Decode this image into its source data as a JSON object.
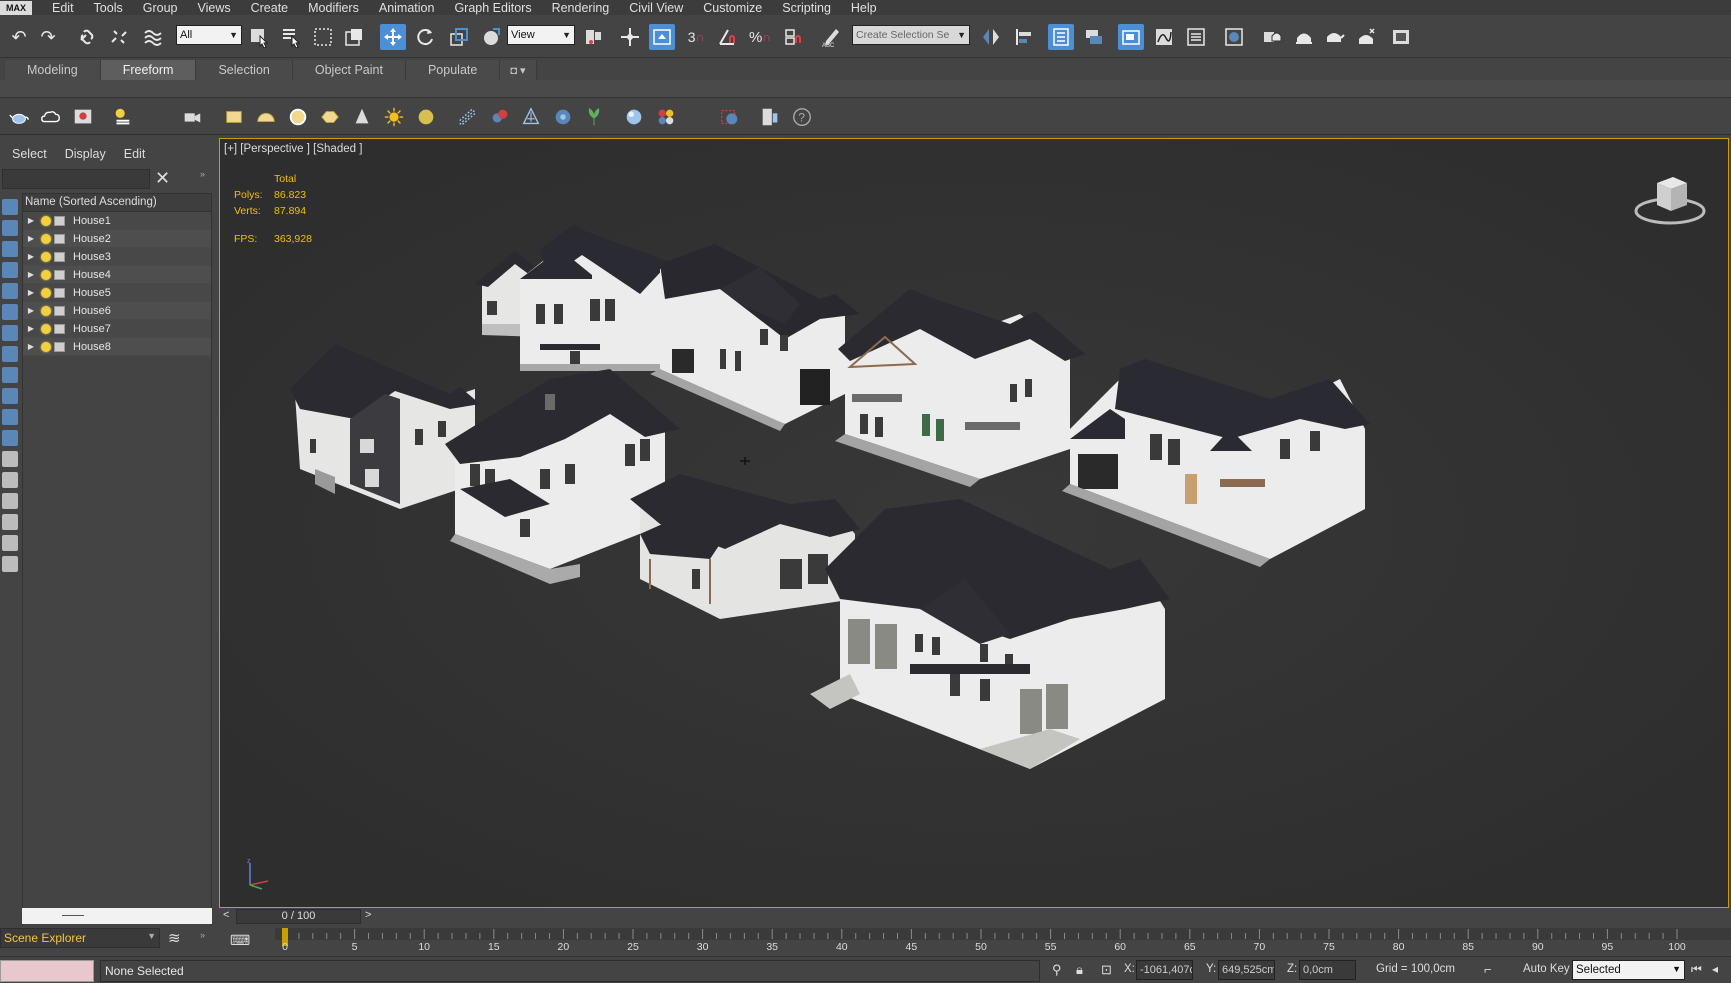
{
  "app": {
    "logo": "MAX"
  },
  "menu": [
    "Edit",
    "Tools",
    "Group",
    "Views",
    "Create",
    "Modifiers",
    "Animation",
    "Graph Editors",
    "Rendering",
    "Civil View",
    "Customize",
    "Scripting",
    "Help"
  ],
  "toolbar": {
    "selection_filter": "All",
    "reference_coord": "View",
    "snap_label": "3",
    "named_selection_placeholder": "Create Selection Se",
    "active_tools": [
      "select-and-move",
      "snap-toggle",
      "layer-explorer"
    ]
  },
  "ribbon": {
    "tabs": [
      "Modeling",
      "Freeform",
      "Selection",
      "Object Paint",
      "Populate"
    ],
    "active": "Freeform"
  },
  "scene_explorer": {
    "tabs": [
      "Select",
      "Display",
      "Edit"
    ],
    "search_value": "",
    "column_header": "Name (Sorted Ascending)",
    "items": [
      "House1",
      "House2",
      "House3",
      "House4",
      "House5",
      "House6",
      "House7",
      "House8"
    ],
    "footer_label": "Scene Explorer"
  },
  "viewport": {
    "label": "[+] [Perspective ] [Shaded ]",
    "stats": {
      "total_label": "Total",
      "polys_label": "Polys:",
      "polys_value": "86.823",
      "verts_label": "Verts:",
      "verts_value": "87.894",
      "fps_label": "FPS:",
      "fps_value": "363,928"
    },
    "border_color": "#c8a000",
    "stats_color": "#f0c000"
  },
  "timeline": {
    "frame_display": "0 / 100",
    "ticks": [
      "0",
      "5",
      "10",
      "15",
      "20",
      "25",
      "30",
      "35",
      "40",
      "45",
      "50",
      "55",
      "60",
      "65",
      "70",
      "75",
      "80",
      "85",
      "90",
      "95",
      "100"
    ],
    "current_frame": 0,
    "total_frames": 100
  },
  "status": {
    "selection_text": "None Selected",
    "x_label": "X:",
    "x_value": "-1061,407c",
    "y_label": "Y:",
    "y_value": "649,525cm",
    "z_label": "Z:",
    "z_value": "0,0cm",
    "grid_text": "Grid = 100,0cm",
    "autokey_label": "Auto Key",
    "key_filter_value": "Selected"
  }
}
